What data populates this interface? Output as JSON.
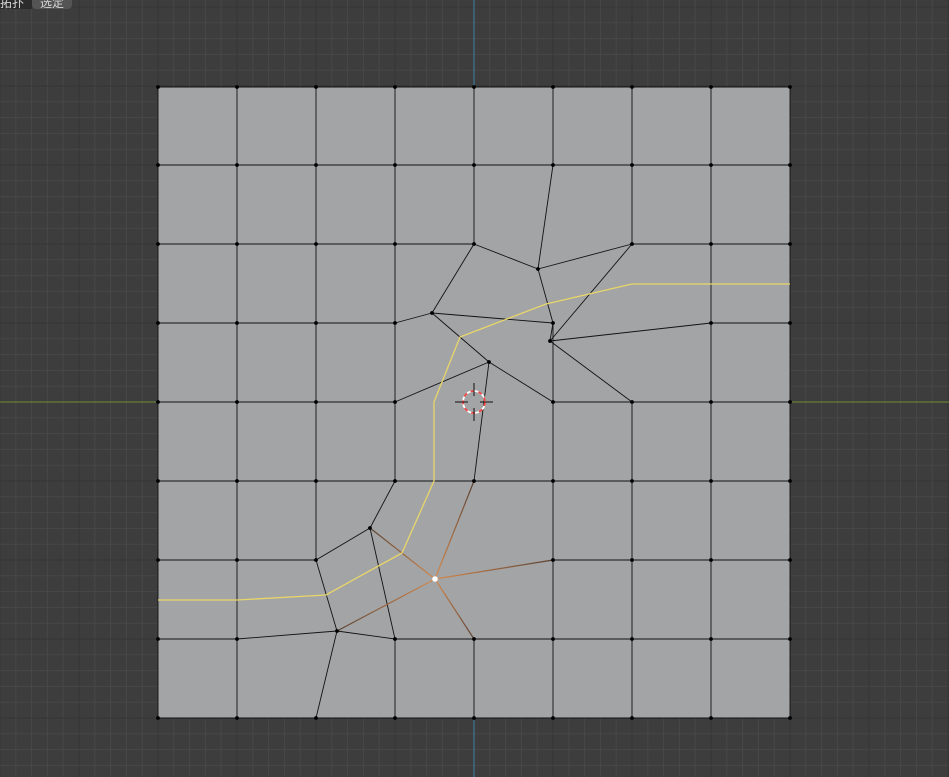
{
  "toolbar": {
    "mode_label": "拓扑",
    "option_label": "选定"
  },
  "colors": {
    "background": "#3d3d3d",
    "grid_minor": "#474747",
    "grid_major": "#353535",
    "x_axis": "#6f8f33",
    "y_axis": "#3f7fa8",
    "face": "#a3a4a5",
    "edge": "#121212",
    "vertex": "#000000",
    "seam": "#e8d66a",
    "selected_edge": "#d68a4e",
    "active_vertex": "#ffffff",
    "cursor_red": "#ee4444"
  },
  "icons": {
    "cursor": "3d-cursor-icon"
  }
}
